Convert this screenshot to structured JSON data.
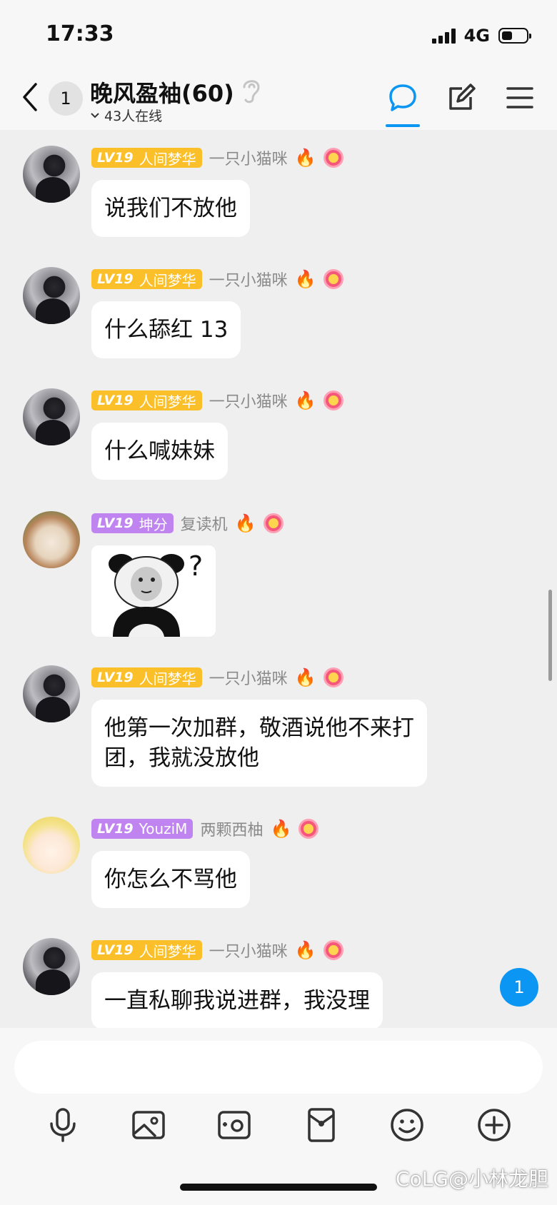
{
  "status_bar": {
    "time": "17:33",
    "network": "4G"
  },
  "header": {
    "back_count": "1",
    "group_title": "晚风盈袖(60)",
    "online": "43人在线"
  },
  "messages": [
    {
      "badge_level": "LV19",
      "badge_title": "人间梦华",
      "nickname": "一只小猫咪",
      "text": "说我们不放他"
    },
    {
      "badge_level": "LV19",
      "badge_title": "人间梦华",
      "nickname": "一只小猫咪",
      "text": "什么舔红 13"
    },
    {
      "badge_level": "LV19",
      "badge_title": "人间梦华",
      "nickname": "一只小猫咪",
      "text": "什么喊妹妹"
    },
    {
      "badge_level": "LV19",
      "badge_title": "坤分",
      "nickname": "复读机",
      "text": ""
    },
    {
      "badge_level": "LV19",
      "badge_title": "人间梦华",
      "nickname": "一只小猫咪",
      "text": "他第一次加群，敬酒说他不来打\n团，我就没放他"
    },
    {
      "badge_level": "LV19",
      "badge_title": "YouziM",
      "nickname": "两颗西柚",
      "text": "你怎么不骂他"
    },
    {
      "badge_level": "LV19",
      "badge_title": "人间梦华",
      "nickname": "一只小猫咪",
      "text": "一直私聊我说进群，我没理"
    }
  ],
  "new_message_count": "1",
  "input": {
    "placeholder": ""
  },
  "watermark": "CoLG@小林龙胆",
  "colors": {
    "accent": "#0a96f2",
    "badge_gold": "#fbbf2a",
    "badge_purple": "#c084f0"
  }
}
